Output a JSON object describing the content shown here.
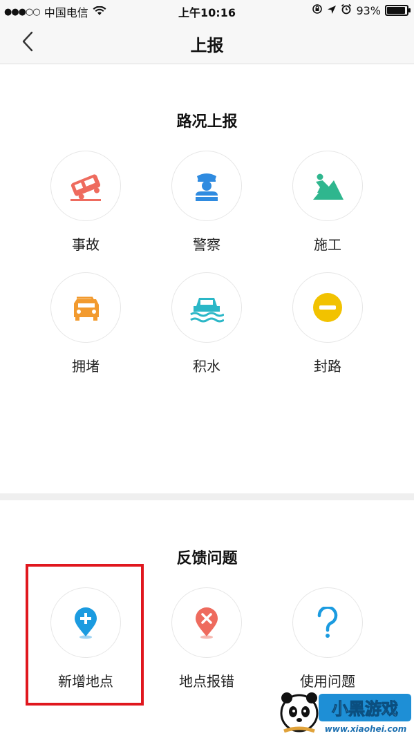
{
  "status_bar": {
    "signal_dots": "●●●○○",
    "carrier": "中国电信",
    "time": "上午10:16",
    "battery_percent": "93%",
    "battery_level": 0.93
  },
  "nav": {
    "title": "上报"
  },
  "road_section": {
    "title": "路况上报",
    "items": [
      {
        "label": "事故",
        "icon": "accident-icon",
        "color": "#ee6b5e"
      },
      {
        "label": "警察",
        "icon": "police-icon",
        "color": "#2f8be0"
      },
      {
        "label": "施工",
        "icon": "construction-icon",
        "color": "#2fb68e"
      },
      {
        "label": "拥堵",
        "icon": "traffic-jam-icon",
        "color": "#f29a2e"
      },
      {
        "label": "积水",
        "icon": "flooding-icon",
        "color": "#2bb7c7"
      },
      {
        "label": "封路",
        "icon": "road-closed-icon",
        "color": "#f2c200"
      }
    ]
  },
  "feedback_section": {
    "title": "反馈问题",
    "items": [
      {
        "label": "新增地点",
        "icon": "add-location-icon",
        "color": "#1b9be0"
      },
      {
        "label": "地点报错",
        "icon": "location-error-icon",
        "color": "#ee6b5e"
      },
      {
        "label": "使用问题",
        "icon": "question-icon",
        "color": "#1b9be0"
      }
    ]
  },
  "watermark": {
    "brand": "小黑游戏",
    "url": "www.xiaohei.com"
  }
}
